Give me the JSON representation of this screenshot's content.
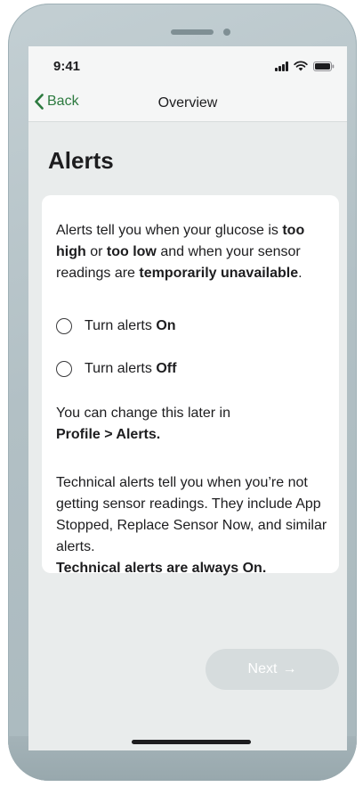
{
  "status_bar": {
    "time": "9:41",
    "signal_icon": "cellular-signal-icon",
    "wifi_icon": "wifi-icon",
    "battery_icon": "battery-icon"
  },
  "nav": {
    "back_label": "Back",
    "back_icon": "chevron-left-icon",
    "title": "Overview",
    "accent_color": "#2c7a3f"
  },
  "page": {
    "title": "Alerts"
  },
  "card": {
    "intro": {
      "t1": "Alerts tell you when your glucose is ",
      "b1": "too high",
      "t2": " or ",
      "b2": "too low",
      "t3": " and when your sensor readings are ",
      "b3": "temporarily unavailable",
      "t4": "."
    },
    "options": [
      {
        "prefix": "Turn alerts ",
        "value": "On",
        "selected": false
      },
      {
        "prefix": "Turn alerts ",
        "value": "Off",
        "selected": false
      }
    ],
    "change_note": {
      "text": "You can change this later in",
      "path": "Profile > Alerts."
    },
    "technical": {
      "text": "Technical alerts tell you when you’re not getting sensor readings. They include App Stopped, Replace Sensor Now, and similar alerts.",
      "bold": "Technical alerts are always On."
    }
  },
  "next_button": {
    "label": "Next",
    "arrow": "→",
    "enabled": false
  }
}
